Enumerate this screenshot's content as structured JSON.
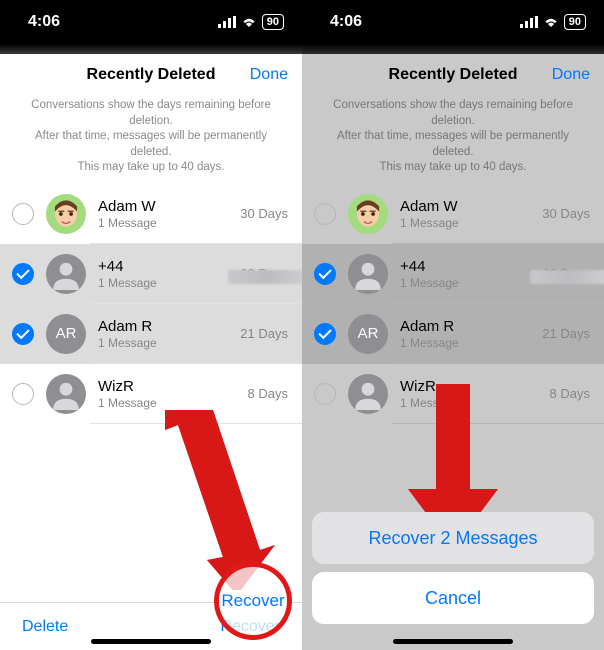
{
  "statusbar": {
    "time": "4:06",
    "battery": "90"
  },
  "nav": {
    "title": "Recently Deleted",
    "done": "Done"
  },
  "info": {
    "l1": "Conversations show the days remaining before deletion.",
    "l2": "After that time, messages will be permanently deleted.",
    "l3": "This may take up to 40 days."
  },
  "rows": [
    {
      "name": "Adam W",
      "sub": "1 Message",
      "days": "30 Days",
      "initials": ""
    },
    {
      "name": "+44",
      "sub": "1 Message",
      "days": "28 Days",
      "initials": ""
    },
    {
      "name": "Adam R",
      "sub": "1 Message",
      "days": "21 Days",
      "initials": "AR"
    },
    {
      "name": "WizR",
      "sub": "1 Message",
      "days": "8 Days",
      "initials": ""
    }
  ],
  "bottombar": {
    "delete": "Delete",
    "recover": "Recover"
  },
  "actionsheet": {
    "recover": "Recover 2 Messages",
    "cancel": "Cancel"
  }
}
